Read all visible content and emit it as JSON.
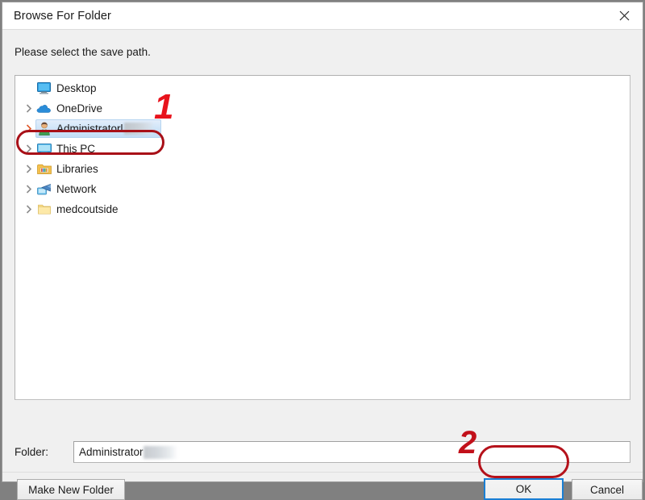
{
  "window": {
    "title": "Browse For Folder",
    "close_icon": "close-icon"
  },
  "prompt": {
    "text": "Please select the save path."
  },
  "tree": {
    "items": [
      {
        "label": "Desktop",
        "icon": "monitor-icon",
        "has_chevron": false,
        "selected": false,
        "redacted": false
      },
      {
        "label": "OneDrive",
        "icon": "cloud-icon",
        "has_chevron": true,
        "selected": false,
        "redacted": false
      },
      {
        "label": "Administratorl",
        "icon": "user-icon",
        "has_chevron": true,
        "selected": true,
        "redacted": true
      },
      {
        "label": "This PC",
        "icon": "computer-icon",
        "has_chevron": true,
        "selected": false,
        "redacted": false
      },
      {
        "label": "Libraries",
        "icon": "libraries-icon",
        "has_chevron": true,
        "selected": false,
        "redacted": false
      },
      {
        "label": "Network",
        "icon": "network-folder-icon",
        "has_chevron": true,
        "selected": false,
        "redacted": false
      },
      {
        "label": "medcoutside",
        "icon": "folder-icon",
        "has_chevron": true,
        "selected": false,
        "redacted": false
      }
    ]
  },
  "folder_field": {
    "label": "Folder:",
    "value": "Administrator",
    "placeholder": ""
  },
  "buttons": {
    "make_new_folder": "Make New Folder",
    "ok": "OK",
    "cancel": "Cancel"
  },
  "annotations": {
    "step_one": "1",
    "step_two": "2"
  },
  "colors": {
    "annotation_red": "#e8131c",
    "annotation_ring_red": "#b0121a",
    "focus_blue": "#1a7fd4",
    "selection_blue": "#cfe4f8",
    "window_background": "#f0f0f0",
    "titlebar_background": "#ffffff",
    "panel_background": "#ffffff",
    "desktop_background": "#808080"
  }
}
